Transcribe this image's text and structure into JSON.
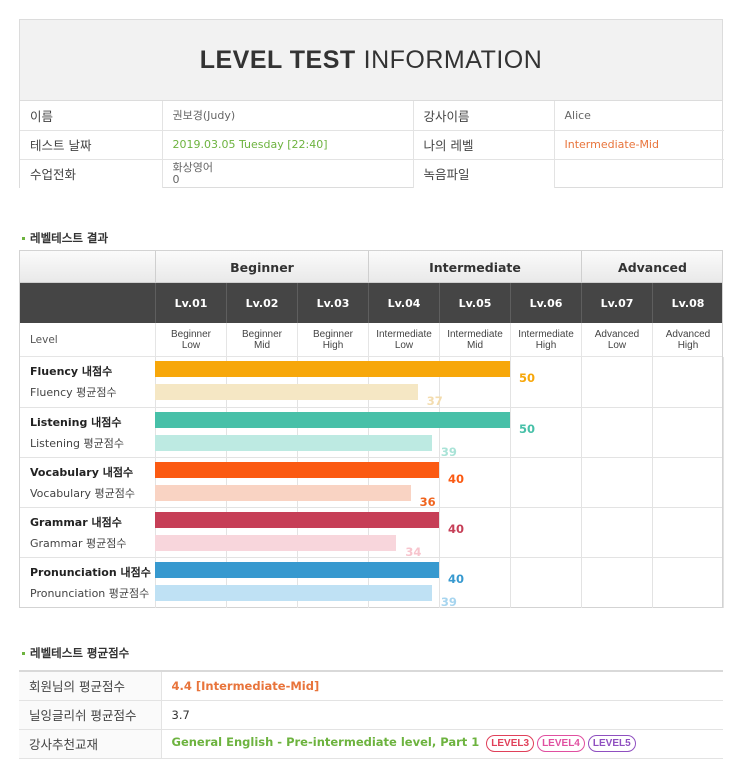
{
  "header": {
    "title_strong": "LEVEL TEST",
    "title_light": "INFORMATION"
  },
  "info": {
    "name_label": "이름",
    "name_value": "권보경(Judy)",
    "teacher_label": "강사이름",
    "teacher_value": "Alice",
    "date_label": "테스트 날짜",
    "date_value": "2019.03.05  Tuesday [22:40]",
    "mylevel_label": "나의 레벨",
    "mylevel_value": "Intermediate-Mid",
    "phone_label": "수업전화",
    "phone_value_line1": "화상영어",
    "phone_value_line2": "0",
    "record_label": "녹음파일",
    "record_value": ""
  },
  "result_section": {
    "title": "레벨테스트 결과",
    "groups": [
      "Beginner",
      "Intermediate",
      "Advanced"
    ],
    "levels": [
      "Lv.01",
      "Lv.02",
      "Lv.03",
      "Lv.04",
      "Lv.05",
      "Lv.06",
      "Lv.07",
      "Lv.08"
    ],
    "level_row_label": "Level",
    "level_names": [
      [
        "Beginner",
        "Low"
      ],
      [
        "Beginner",
        "Mid"
      ],
      [
        "Beginner",
        "High"
      ],
      [
        "Intermediate",
        "Low"
      ],
      [
        "Intermediate",
        "Mid"
      ],
      [
        "Intermediate",
        "High"
      ],
      [
        "Advanced",
        "Low"
      ],
      [
        "Advanced",
        "High"
      ]
    ],
    "skills": [
      {
        "name": "Fluency 내점수",
        "avg_name": "Fluency 평균점수",
        "score": 50,
        "avg": 37,
        "color": "#f7a70a",
        "avg_color": "#f5e7c4",
        "avg_text_color": "#f3dcae"
      },
      {
        "name": "Listening 내점수",
        "avg_name": "Listening 평균점수",
        "score": 50,
        "avg": 39,
        "color": "#47c0a8",
        "avg_color": "#bdeae2",
        "avg_text_color": "#a9e3d7"
      },
      {
        "name": "Vocabulary 내점수",
        "avg_name": "Vocabulary 평균점수",
        "score": 40,
        "avg": 36,
        "color": "#fb5a12",
        "avg_color": "#f9d3c3",
        "avg_text_color": "#f0641e"
      },
      {
        "name": "Grammar 내점수",
        "avg_name": "Grammar 평균점수",
        "score": 40,
        "avg": 34,
        "color": "#c63f57",
        "avg_color": "#f8d6dc",
        "avg_text_color": "#f7c4cd"
      },
      {
        "name": "Pronunciation 내점수",
        "avg_name": "Pronunciation 평균점수",
        "score": 40,
        "avg": 39,
        "color": "#3799cf",
        "avg_color": "#bfe1f4",
        "avg_text_color": "#a7d5ef"
      }
    ]
  },
  "average_section": {
    "title": "레벨테스트 평균점수",
    "member_avg_label": "회원님의 평균점수",
    "member_avg_value": "4.4 [Intermediate-Mid]",
    "overall_avg_label": "닐잉글리쉬 평균점수",
    "overall_avg_value": "3.7",
    "recommend_label": "강사추천교재",
    "recommend_value": "General English - Pre-intermediate level, Part 1",
    "badges": [
      {
        "text": "LEVEL3",
        "color": "#e0405a"
      },
      {
        "text": "LEVEL4",
        "color": "#e04fa0"
      },
      {
        "text": "LEVEL5",
        "color": "#8f4fc0"
      }
    ]
  }
}
